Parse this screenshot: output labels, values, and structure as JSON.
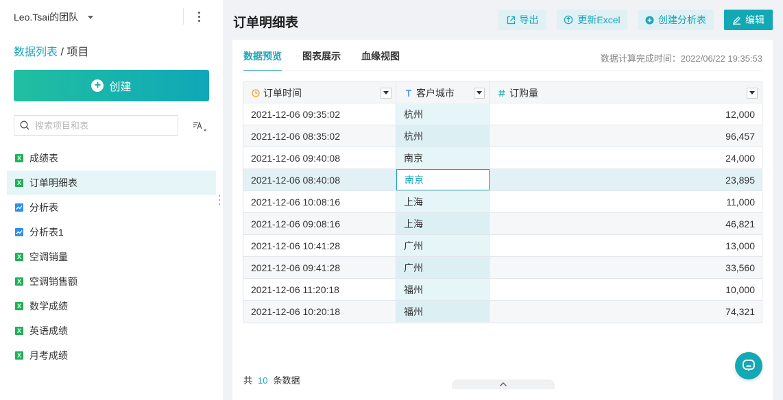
{
  "sidebar": {
    "team_name": "Leo.Tsai的团队",
    "breadcrumb": {
      "link": "数据列表",
      "separator": " / ",
      "current": "项目"
    },
    "create_label": "创建",
    "search_placeholder": "搜索项目和表",
    "items": [
      {
        "label": "成绩表",
        "icon": "excel-icon"
      },
      {
        "label": "订单明细表",
        "icon": "excel-icon",
        "active": true
      },
      {
        "label": "分析表",
        "icon": "analysis-icon"
      },
      {
        "label": "分析表1",
        "icon": "analysis-icon"
      },
      {
        "label": "空调销量",
        "icon": "excel-icon"
      },
      {
        "label": "空调销售额",
        "icon": "excel-icon"
      },
      {
        "label": "数学成绩",
        "icon": "excel-icon"
      },
      {
        "label": "英语成绩",
        "icon": "excel-icon"
      },
      {
        "label": "月考成绩",
        "icon": "excel-icon"
      }
    ]
  },
  "main": {
    "title": "订单明细表",
    "toolbar": {
      "export_label": "导出",
      "refresh_label": "更新Excel",
      "create_analysis_label": "创建分析表",
      "edit_label": "编辑"
    },
    "tabs": [
      {
        "label": "数据预览",
        "active": true
      },
      {
        "label": "图表展示"
      },
      {
        "label": "血缘视图"
      }
    ],
    "calc_time": "数据计算完成时间：2022/06/22 19:35:53",
    "table": {
      "columns": [
        {
          "label": "订单时间",
          "type_icon": "clock-icon"
        },
        {
          "label": "客户城市",
          "type_icon": "text-type-icon"
        },
        {
          "label": "订购量",
          "type_icon": "number-type-icon"
        }
      ],
      "rows": [
        [
          "2021-12-06 09:35:02",
          "杭州",
          "12,000"
        ],
        [
          "2021-12-06 08:35:02",
          "杭州",
          "96,457"
        ],
        [
          "2021-12-06 09:40:08",
          "南京",
          "24,000"
        ],
        [
          "2021-12-06 08:40:08",
          "南京",
          "23,895"
        ],
        [
          "2021-12-06 10:08:16",
          "上海",
          "11,000"
        ],
        [
          "2021-12-06 09:08:16",
          "上海",
          "46,821"
        ],
        [
          "2021-12-06 10:41:28",
          "广州",
          "13,000"
        ],
        [
          "2021-12-06 09:41:28",
          "广州",
          "33,560"
        ],
        [
          "2021-12-06 11:20:18",
          "福州",
          "10,000"
        ],
        [
          "2021-12-06 10:20:18",
          "福州",
          "74,321"
        ]
      ],
      "selected_row": 3
    },
    "footer": {
      "prefix": "共",
      "count": "10",
      "suffix": "条数据"
    }
  },
  "colors": {
    "accent": "#1ba5b8",
    "button_bg": "#dff1f4",
    "excel": "#1fb155",
    "analysis": "#2f8fea"
  }
}
